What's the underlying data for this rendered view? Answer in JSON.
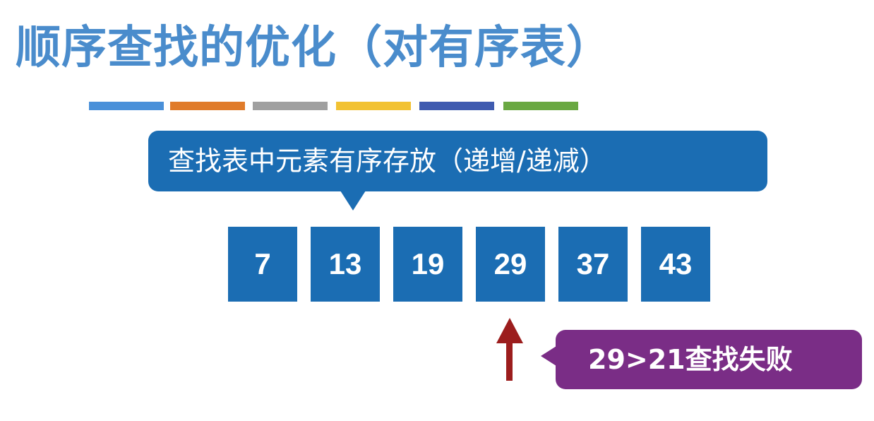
{
  "title": "顺序查找的优化（对有序表）",
  "stripes": [
    "#4a90d9",
    "#e07b2a",
    "#a0a0a0",
    "#f2c232",
    "#3f5bb0",
    "#6aa842"
  ],
  "callout": {
    "text": "查找表中元素有序存放（递增/递减）"
  },
  "cells": [
    "7",
    "13",
    "19",
    "29",
    "37",
    "43"
  ],
  "result": {
    "text": "29>21查找失败"
  },
  "colors": {
    "title": "#4a8ccc",
    "cell": "#1b6db3",
    "arrow": "#9c1d1d",
    "result": "#7a2d86"
  }
}
